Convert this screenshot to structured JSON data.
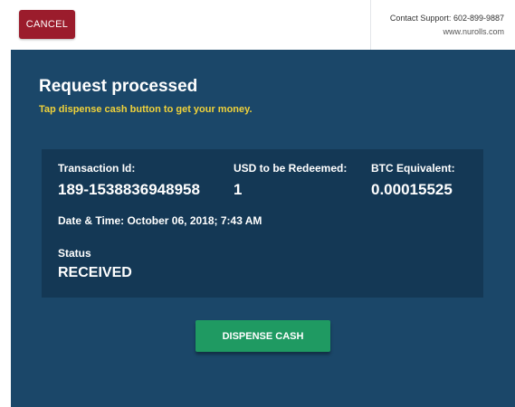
{
  "topbar": {
    "cancel_label": "CANCEL",
    "support_label": "Contact Support:",
    "support_phone": "602-899-9887",
    "website": "www.nurolls.com"
  },
  "header": {
    "title": "Request processed",
    "subtitle": "Tap dispense cash button to get your money."
  },
  "transaction": {
    "id_label": "Transaction Id:",
    "id_value": "189-1538836948958",
    "usd_label": "USD to be Redeemed:",
    "usd_value": "1",
    "btc_label": "BTC Equivalent:",
    "btc_value": "0.00015525",
    "datetime_text": "Date & Time: October 06, 2018; 7:43 AM",
    "status_label": "Status",
    "status_value": "RECEIVED"
  },
  "actions": {
    "dispense_label": "DISPENSE CASH"
  },
  "colors": {
    "panel_bg": "#1b4769",
    "card_bg": "#143855",
    "cancel_bg": "#9b1c2c",
    "dispense_bg": "#1f9a62",
    "subtitle_color": "#f0d23a"
  }
}
